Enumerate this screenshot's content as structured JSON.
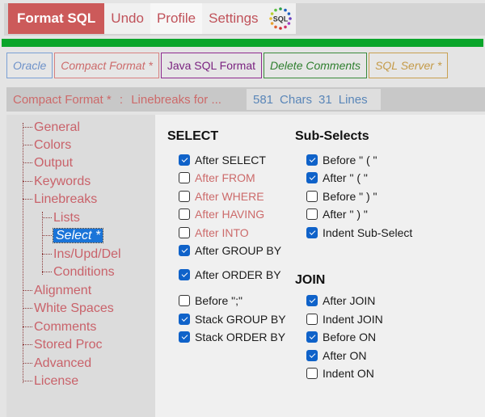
{
  "toolbar": {
    "format_label": "Format SQL",
    "undo_label": "Undo",
    "profile_label": "Profile",
    "settings_label": "Settings",
    "logo_text": "SQL",
    "progress_percent": 100,
    "progress_color": "#0aa52a"
  },
  "profiles": [
    {
      "label": "Oracle",
      "color": "#6d91c9"
    },
    {
      "label": "Compact Format *",
      "color": "#cc6a6a"
    },
    {
      "label": "Java SQL Format",
      "color": "#7a2380"
    },
    {
      "label": "Delete Comments",
      "color": "#2f7f2f"
    },
    {
      "label": "SQL Server *",
      "color": "#c49a48"
    }
  ],
  "status": {
    "profile": "Compact Format *",
    "separator": ":",
    "description": "Linebreaks for ...",
    "chars_count": "581",
    "chars_label": "Chars",
    "lines_count": "31",
    "lines_label": "Lines"
  },
  "tree": {
    "items": [
      {
        "label": "General"
      },
      {
        "label": "Colors"
      },
      {
        "label": "Output"
      },
      {
        "label": "Keywords"
      },
      {
        "label": "Linebreaks"
      },
      {
        "label": "Lists"
      },
      {
        "label": "Select *",
        "selected": true
      },
      {
        "label": "Ins/Upd/Del"
      },
      {
        "label": "Conditions"
      },
      {
        "label": "Alignment"
      },
      {
        "label": "White Spaces"
      },
      {
        "label": "Comments"
      },
      {
        "label": "Stored Proc"
      },
      {
        "label": "Advanced"
      },
      {
        "label": "License"
      }
    ]
  },
  "select": {
    "title": "SELECT",
    "options": [
      {
        "label": "After SELECT",
        "checked": true,
        "enabled": true
      },
      {
        "label": "After FROM",
        "checked": false,
        "enabled": false
      },
      {
        "label": "After WHERE",
        "checked": false,
        "enabled": false
      },
      {
        "label": "After HAVING",
        "checked": false,
        "enabled": false
      },
      {
        "label": "After INTO",
        "checked": false,
        "enabled": false
      },
      {
        "label": "After GROUP BY",
        "checked": true,
        "enabled": true
      },
      {
        "label": "After ORDER BY",
        "checked": true,
        "enabled": true
      },
      {
        "label": "Before \";\"",
        "checked": false,
        "enabled": true
      },
      {
        "label": "Stack GROUP BY",
        "checked": true,
        "enabled": true
      },
      {
        "label": "Stack ORDER BY",
        "checked": true,
        "enabled": true
      }
    ]
  },
  "subselects": {
    "title": "Sub-Selects",
    "options": [
      {
        "label": "Before \" ( \"",
        "checked": true
      },
      {
        "label": "After \" ( \"",
        "checked": true
      },
      {
        "label": "Before \" ) \"",
        "checked": false
      },
      {
        "label": "After \" ) \"",
        "checked": false
      },
      {
        "label": "Indent Sub-Select",
        "checked": true
      }
    ]
  },
  "join": {
    "title": "JOIN",
    "options": [
      {
        "label": "After JOIN",
        "checked": true
      },
      {
        "label": "Indent JOIN",
        "checked": false
      },
      {
        "label": "Before ON",
        "checked": true
      },
      {
        "label": "After ON",
        "checked": true
      },
      {
        "label": "Indent ON",
        "checked": false
      }
    ]
  }
}
